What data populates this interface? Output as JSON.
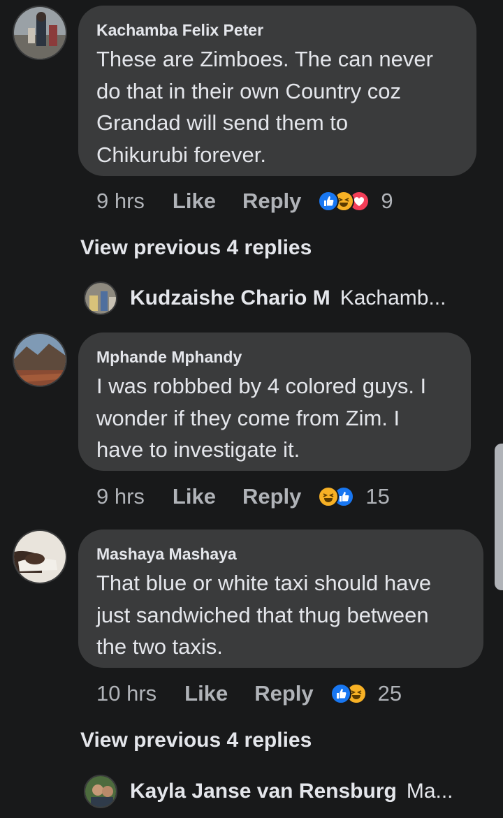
{
  "comments": [
    {
      "author": "Kachamba Felix Peter",
      "text": "These are Zimboes. The can never\ndo that in their own Country coz\nGrandad will  send them to\nChikurubi forever.",
      "time": "9 hrs",
      "like": "Like",
      "reply": "Reply",
      "reaction_icons": [
        "like-reaction-icon",
        "haha-reaction-icon",
        "love-reaction-icon"
      ],
      "reaction_count": "9"
    },
    {
      "author": "Mphande Mphandy",
      "text": "I was robbbed by 4 colored guys. I\nwonder if they come from Zim. I\nhave to investigate it.",
      "time": "9 hrs",
      "like": "Like",
      "reply": "Reply",
      "reaction_icons": [
        "haha-reaction-icon",
        "like-reaction-icon"
      ],
      "reaction_count": "15"
    },
    {
      "author": "Mashaya Mashaya",
      "text": "That blue or white taxi should have\njust sandwiched that thug between\nthe two taxis.",
      "time": "10 hrs",
      "like": "Like",
      "reply": "Reply",
      "reaction_icons": [
        "like-reaction-icon",
        "haha-reaction-icon"
      ],
      "reaction_count": "25"
    }
  ],
  "threads": [
    {
      "view_previous": "View previous 4 replies",
      "last_reply_author": "Kudzaishe Chario M",
      "last_reply_snippet": "Kachamb..."
    },
    {
      "view_previous": "View previous 4 replies",
      "last_reply_author": "Kayla Janse van Rensburg",
      "last_reply_snippet": "Ma..."
    }
  ],
  "colors": {
    "background": "#18191a",
    "bubble": "#3a3b3c",
    "primary_text": "#e4e6eb",
    "secondary_text": "#b0b3b8",
    "like_blue": "#1877f2",
    "haha_yellow": "#f7b125",
    "love_red": "#f33e58"
  }
}
